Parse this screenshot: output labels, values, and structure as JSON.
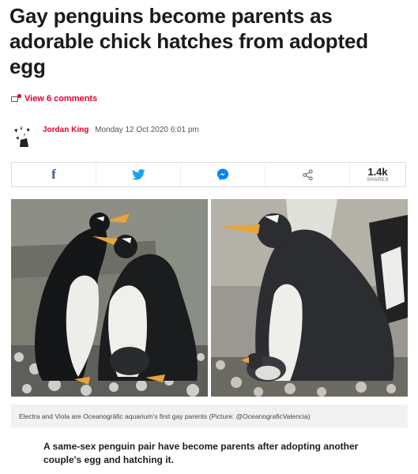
{
  "article": {
    "headline": "Gay penguins become parents as adorable chick hatches from adopted egg",
    "comments_label": "View 6 comments",
    "author": "Jordan King",
    "date": "Monday 12 Oct 2020 6:01 pm",
    "caption": "Electra and Viola are Oceanogràfic aquarium's first gay parents (Picture: @OceanograficValencia)",
    "lede": "A same-sex penguin pair have become parents after adopting another couple's egg and hatching it."
  },
  "share": {
    "buttons": [
      {
        "name": "facebook",
        "icon": "facebook-icon",
        "color": "#3b5998"
      },
      {
        "name": "twitter",
        "icon": "twitter-icon",
        "color": "#1da1f2"
      },
      {
        "name": "messenger",
        "icon": "messenger-icon",
        "color": "#0084ff"
      },
      {
        "name": "share",
        "icon": "share-icon",
        "color": "#777777"
      }
    ],
    "count": "1.4k",
    "count_label": "SHARES"
  },
  "colors": {
    "accent": "#e4002b",
    "text": "#1b1b1b",
    "caption_bg": "#f1f1f1"
  }
}
